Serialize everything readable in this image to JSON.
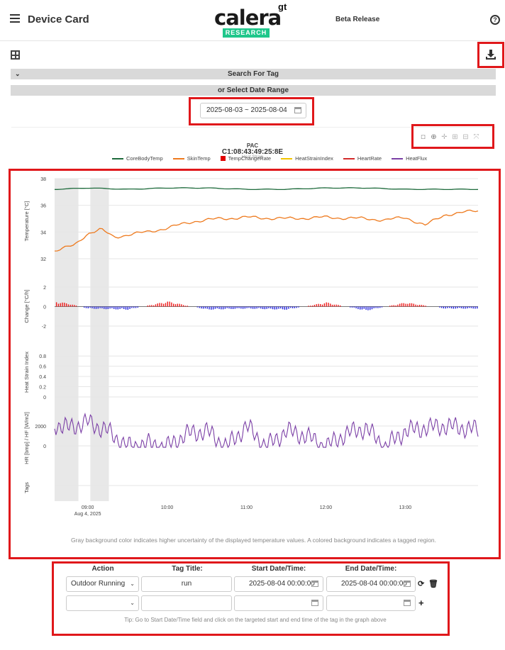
{
  "header": {
    "title": "Device Card",
    "logo_word": "calera",
    "logo_sup": "gt",
    "logo_badge": "RESEARCH",
    "beta_label": "Beta Release",
    "help_label": "?"
  },
  "filters": {
    "tag_bar_label": "Search For Tag",
    "date_bar_label": "or Select Date Range",
    "date_range_value": "2025-08-03 ~ 2025-08-04"
  },
  "plot": {
    "title": "PAC",
    "device_id": "C1:08:43:49:25:8E",
    "overlapped_subtitle": "Heat Strain",
    "legend": [
      {
        "name": "CoreBodyTemp",
        "color": "#1e6b3c",
        "kind": "line"
      },
      {
        "name": "SkinTemp",
        "color": "#ee7a1e",
        "kind": "line"
      },
      {
        "name": "TempChangeRate",
        "color": "#e00000",
        "kind": "square"
      },
      {
        "name": "HeatStrainIndex",
        "color": "#f2c400",
        "kind": "line"
      },
      {
        "name": "HeartRate",
        "color": "#d22b2b",
        "kind": "line"
      },
      {
        "name": "HeatFlux",
        "color": "#7b3fa6",
        "kind": "line"
      }
    ],
    "panels": [
      {
        "ylabel": "Temperature [°C]",
        "ticks": [
          "38",
          "36",
          "34",
          "32"
        ]
      },
      {
        "ylabel": "Change [°C/h]",
        "ticks": [
          "2",
          "0",
          "-2"
        ]
      },
      {
        "ylabel": "Heat Strain Index",
        "ticks": [
          "0.8",
          "0.6",
          "0.4",
          "0.2",
          "0"
        ]
      },
      {
        "ylabel": "HR [bmp] / HF [W/m2]",
        "ticks": [
          "2000",
          "0"
        ]
      },
      {
        "ylabel": "Tags",
        "ticks": []
      }
    ],
    "x_ticks": [
      "09:00",
      "10:00",
      "11:00",
      "12:00",
      "13:00"
    ],
    "x_date": "Aug 4, 2025",
    "note": "Gray background color indicates higher uncertainty of the displayed temperature values. A colored background indicates a tagged region."
  },
  "chart_data": {
    "type": "line",
    "title": "PAC",
    "x_unit": "time",
    "xlim": [
      "08:35",
      "13:55"
    ],
    "uncertainty_regions": [
      [
        "08:35",
        "08:53"
      ],
      [
        "09:02",
        "09:16"
      ]
    ],
    "series": [
      {
        "name": "CoreBodyTemp",
        "x": [
          "08:35",
          "09:00",
          "09:30",
          "10:00",
          "10:30",
          "11:00",
          "11:30",
          "12:00",
          "12:30",
          "13:00",
          "13:30",
          "13:55"
        ],
        "values": [
          37.2,
          37.3,
          37.2,
          37.3,
          37.3,
          37.2,
          37.2,
          37.3,
          37.3,
          37.2,
          37.2,
          37.2
        ]
      },
      {
        "name": "SkinTemp",
        "x": [
          "08:35",
          "08:50",
          "09:00",
          "09:10",
          "09:20",
          "09:30",
          "09:45",
          "10:00",
          "10:20",
          "10:40",
          "11:00",
          "11:30",
          "12:00",
          "12:30",
          "12:45",
          "13:00",
          "13:15",
          "13:30",
          "13:55"
        ],
        "values": [
          32.6,
          33.0,
          33.9,
          34.2,
          33.6,
          33.8,
          34.0,
          34.3,
          34.8,
          35.0,
          35.1,
          35.0,
          35.1,
          35.0,
          34.9,
          35.1,
          34.5,
          35.3,
          35.6
        ]
      },
      {
        "name": "TempChangeRate",
        "x": [
          "08:35",
          "08:45",
          "09:00",
          "09:30",
          "10:00",
          "10:30",
          "11:00",
          "11:30",
          "12:00",
          "12:30",
          "13:00",
          "13:30",
          "13:55"
        ],
        "values": [
          0.5,
          0.3,
          -0.2,
          -0.3,
          0.5,
          -0.3,
          -0.2,
          -0.3,
          0.4,
          -0.4,
          0.4,
          -0.2,
          -0.2
        ]
      },
      {
        "name": "HeatFlux",
        "x": [
          "08:35",
          "08:45",
          "09:00",
          "09:15",
          "09:30",
          "09:45",
          "10:00",
          "10:15",
          "10:30",
          "10:45",
          "11:00",
          "11:15",
          "11:30",
          "11:45",
          "12:00",
          "12:15",
          "12:30",
          "12:45",
          "13:00",
          "13:15",
          "13:30",
          "13:45",
          "13:55"
        ],
        "values": [
          2200,
          1800,
          2400,
          1500,
          -100,
          200,
          -100,
          1200,
          1500,
          -100,
          2000,
          -100,
          1500,
          1000,
          -100,
          1200,
          1800,
          -100,
          1500,
          1800,
          2000,
          1800,
          1600
        ]
      }
    ]
  },
  "tag_form": {
    "headers": [
      "Action",
      "Tag Title:",
      "Start Date/Time:",
      "End Date/Time:"
    ],
    "row1": {
      "action": "Outdoor Running",
      "title": "run",
      "start": "2025-08-04 00:00:00",
      "end": "2025-08-04 00:00:00"
    },
    "row2": {
      "action": "",
      "title": "",
      "start": "",
      "end": ""
    },
    "tip": "Tip: Go to Start Date/Time field and click on the targeted start and end time of the tag in the graph above"
  }
}
